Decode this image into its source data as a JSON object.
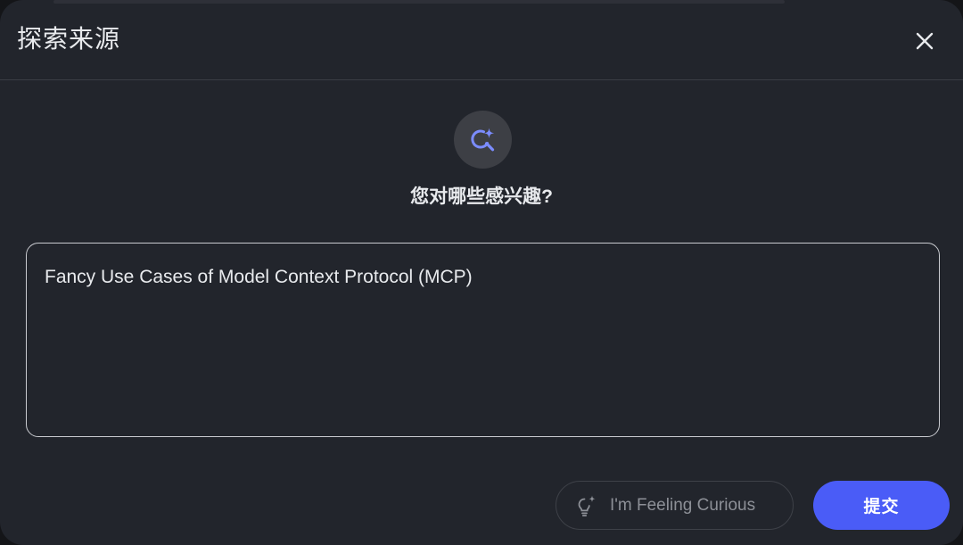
{
  "dialog": {
    "title": "探索来源",
    "close_icon": "close-icon"
  },
  "hero": {
    "icon": "sparkle-search-icon",
    "icon_color": "#7b8cff",
    "question": "您对哪些感兴趣?"
  },
  "query": {
    "value": "Fancy Use Cases of Model Context Protocol (MCP)"
  },
  "actions": {
    "curious_icon": "lightbulb-sparkle-icon",
    "curious_label": "I'm Feeling Curious",
    "submit_label": "提交",
    "submit_color": "#4a5cf7"
  }
}
